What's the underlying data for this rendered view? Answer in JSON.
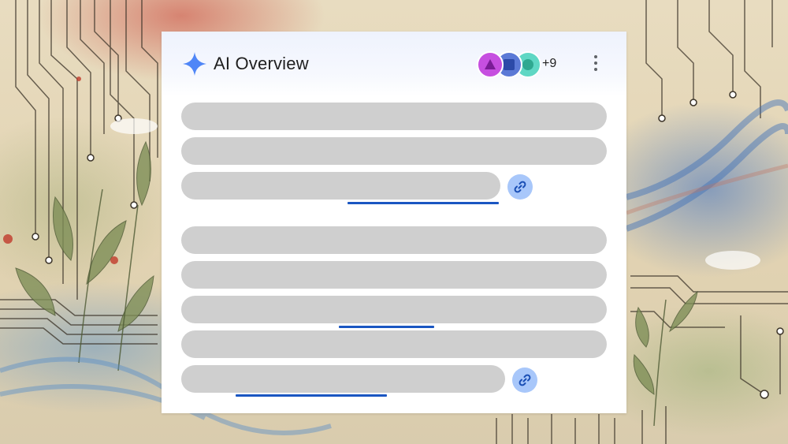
{
  "overview": {
    "title": "AI Overview",
    "sparkle_icon": "sparkle-icon",
    "avatar_more_count": "+9",
    "menu_icon": "more-vert-icon"
  },
  "colors": {
    "sparkle": "#4f86f7",
    "avatar_1": "#c64fe0",
    "avatar_2": "#5b79d6",
    "avatar_3": "#5fd7c4",
    "placeholder_bar": "#cfcfcf",
    "link_underline": "#1a56c2",
    "link_button": "#a8c7fa"
  },
  "placeholder_paragraphs": [
    {
      "lines": 3,
      "has_source_link": true
    },
    {
      "lines": 5,
      "has_source_link": true
    }
  ]
}
